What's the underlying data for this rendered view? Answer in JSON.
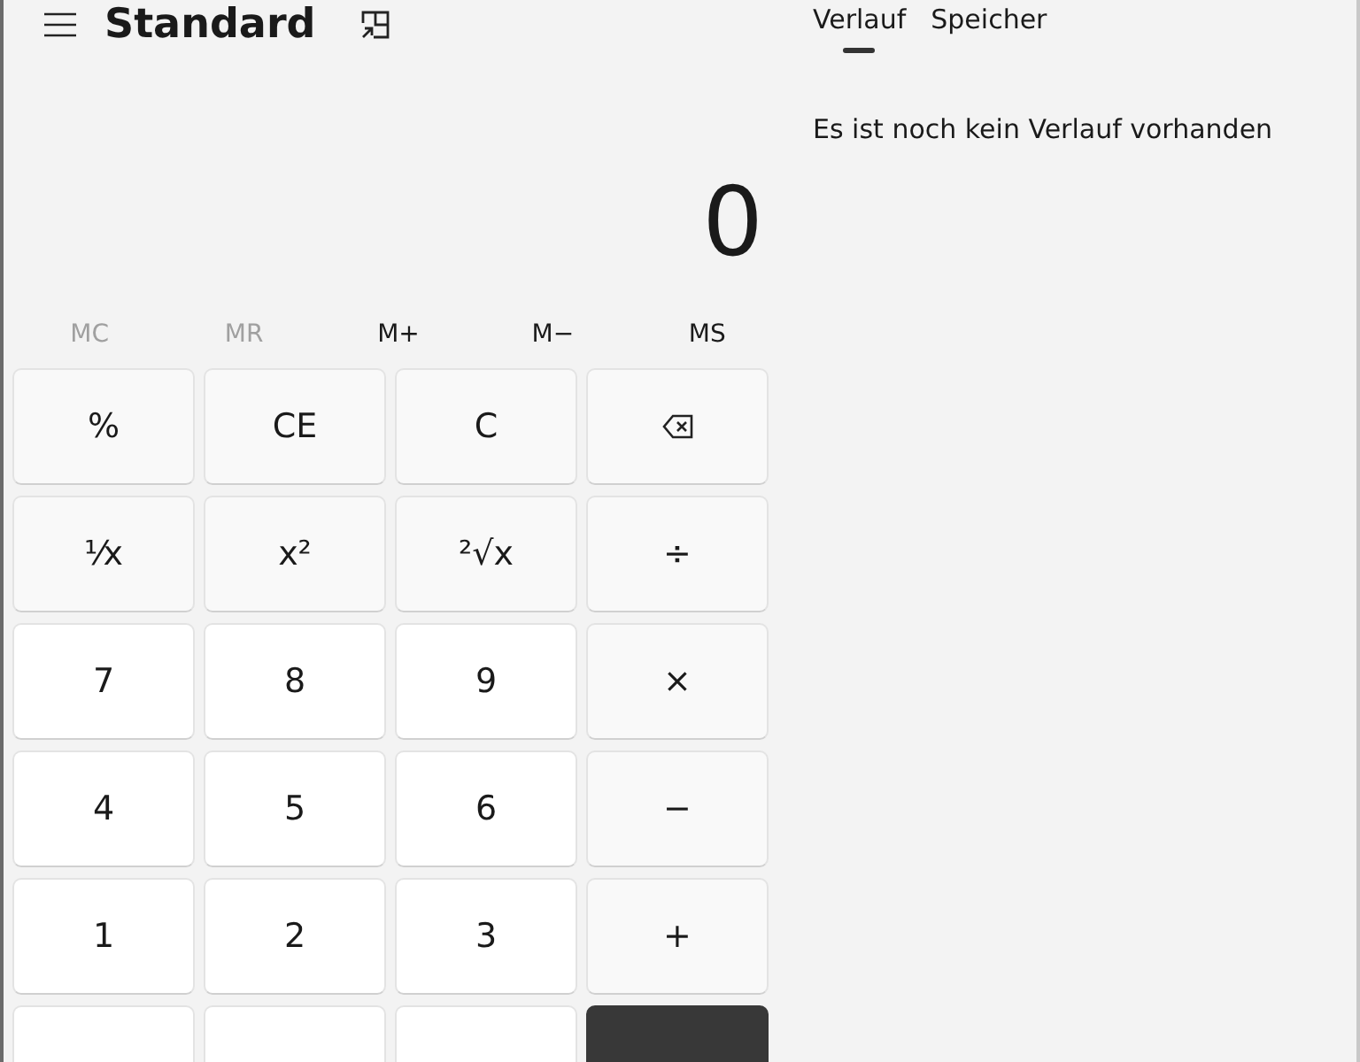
{
  "header": {
    "title": "Standard"
  },
  "display": {
    "value": "0"
  },
  "memory": [
    {
      "label": "MC",
      "disabled": true
    },
    {
      "label": "MR",
      "disabled": true
    },
    {
      "label": "M+",
      "disabled": false
    },
    {
      "label": "M−",
      "disabled": false
    },
    {
      "label": "MS",
      "disabled": false
    }
  ],
  "keys": [
    {
      "kind": "op",
      "label": "%"
    },
    {
      "kind": "op",
      "label": "CE"
    },
    {
      "kind": "op",
      "label": "C"
    },
    {
      "kind": "backspace"
    },
    {
      "kind": "op",
      "label": "⅟x"
    },
    {
      "kind": "op",
      "label": "x²"
    },
    {
      "kind": "op",
      "label": "²√x"
    },
    {
      "kind": "op",
      "label": "÷"
    },
    {
      "kind": "digit",
      "label": "7"
    },
    {
      "kind": "digit",
      "label": "8"
    },
    {
      "kind": "digit",
      "label": "9"
    },
    {
      "kind": "op",
      "label": "×"
    },
    {
      "kind": "digit",
      "label": "4"
    },
    {
      "kind": "digit",
      "label": "5"
    },
    {
      "kind": "digit",
      "label": "6"
    },
    {
      "kind": "op",
      "label": "−"
    },
    {
      "kind": "digit",
      "label": "1"
    },
    {
      "kind": "digit",
      "label": "2"
    },
    {
      "kind": "digit",
      "label": "3"
    },
    {
      "kind": "op",
      "label": "+"
    },
    {
      "kind": "digit"
    },
    {
      "kind": "digit"
    },
    {
      "kind": "digit"
    },
    {
      "kind": "equals"
    }
  ],
  "tabs": [
    {
      "label": "Verlauf",
      "selected": true
    },
    {
      "label": "Speicher",
      "selected": false
    }
  ],
  "history": {
    "empty_message": "Es ist noch kein Verlauf vorhanden"
  }
}
